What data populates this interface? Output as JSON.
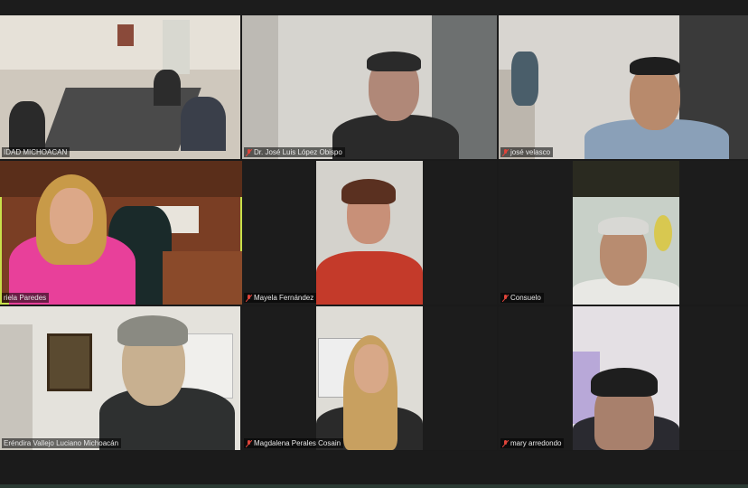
{
  "participants": [
    {
      "name": "IDAD MICHOACAN",
      "muted": false,
      "active": false
    },
    {
      "name": "Dr. José Luis López Obispo",
      "muted": true,
      "active": false
    },
    {
      "name": "josé velasco",
      "muted": true,
      "active": false
    },
    {
      "name": "riela Paredes",
      "muted": false,
      "active": true
    },
    {
      "name": "Mayela Fernández",
      "muted": true,
      "active": false
    },
    {
      "name": "Consuelo",
      "muted": true,
      "active": false
    },
    {
      "name": "Eréndira Vallejo Luciano Michoacán",
      "muted": false,
      "active": false
    },
    {
      "name": "Magdalena Perales Cosain",
      "muted": true,
      "active": false
    },
    {
      "name": "mary arredondo",
      "muted": true,
      "active": false
    }
  ],
  "colors": {
    "active_border": "#c8e04a",
    "mute_icon": "#e0443a",
    "background": "#1a1a1a"
  }
}
